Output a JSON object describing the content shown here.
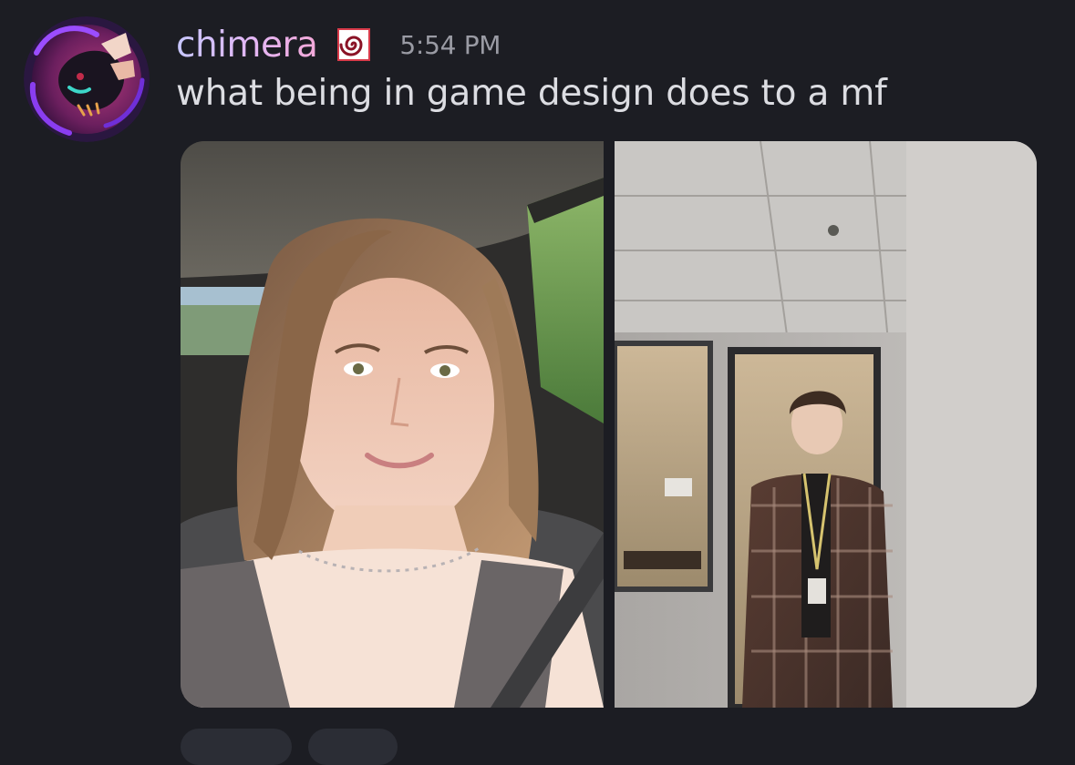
{
  "message": {
    "username": "chimera",
    "timestamp": "5:54 PM",
    "text": "what being in game design does to a mf",
    "role_icon": "spiral-role-icon",
    "avatar_icon": "dragon-avatar"
  },
  "attachments": [
    {
      "name": "car-selfie-photo",
      "icon": "image"
    },
    {
      "name": "office-hallway-photo",
      "icon": "image"
    }
  ],
  "colors": {
    "background": "#1c1d23",
    "username_gradient_start": "#c7c7ff",
    "username_gradient_end": "#f3a8d8",
    "message_text": "#dcdde2",
    "timestamp": "#9a9ba4",
    "avatar_ring": "#7b2fd0"
  }
}
